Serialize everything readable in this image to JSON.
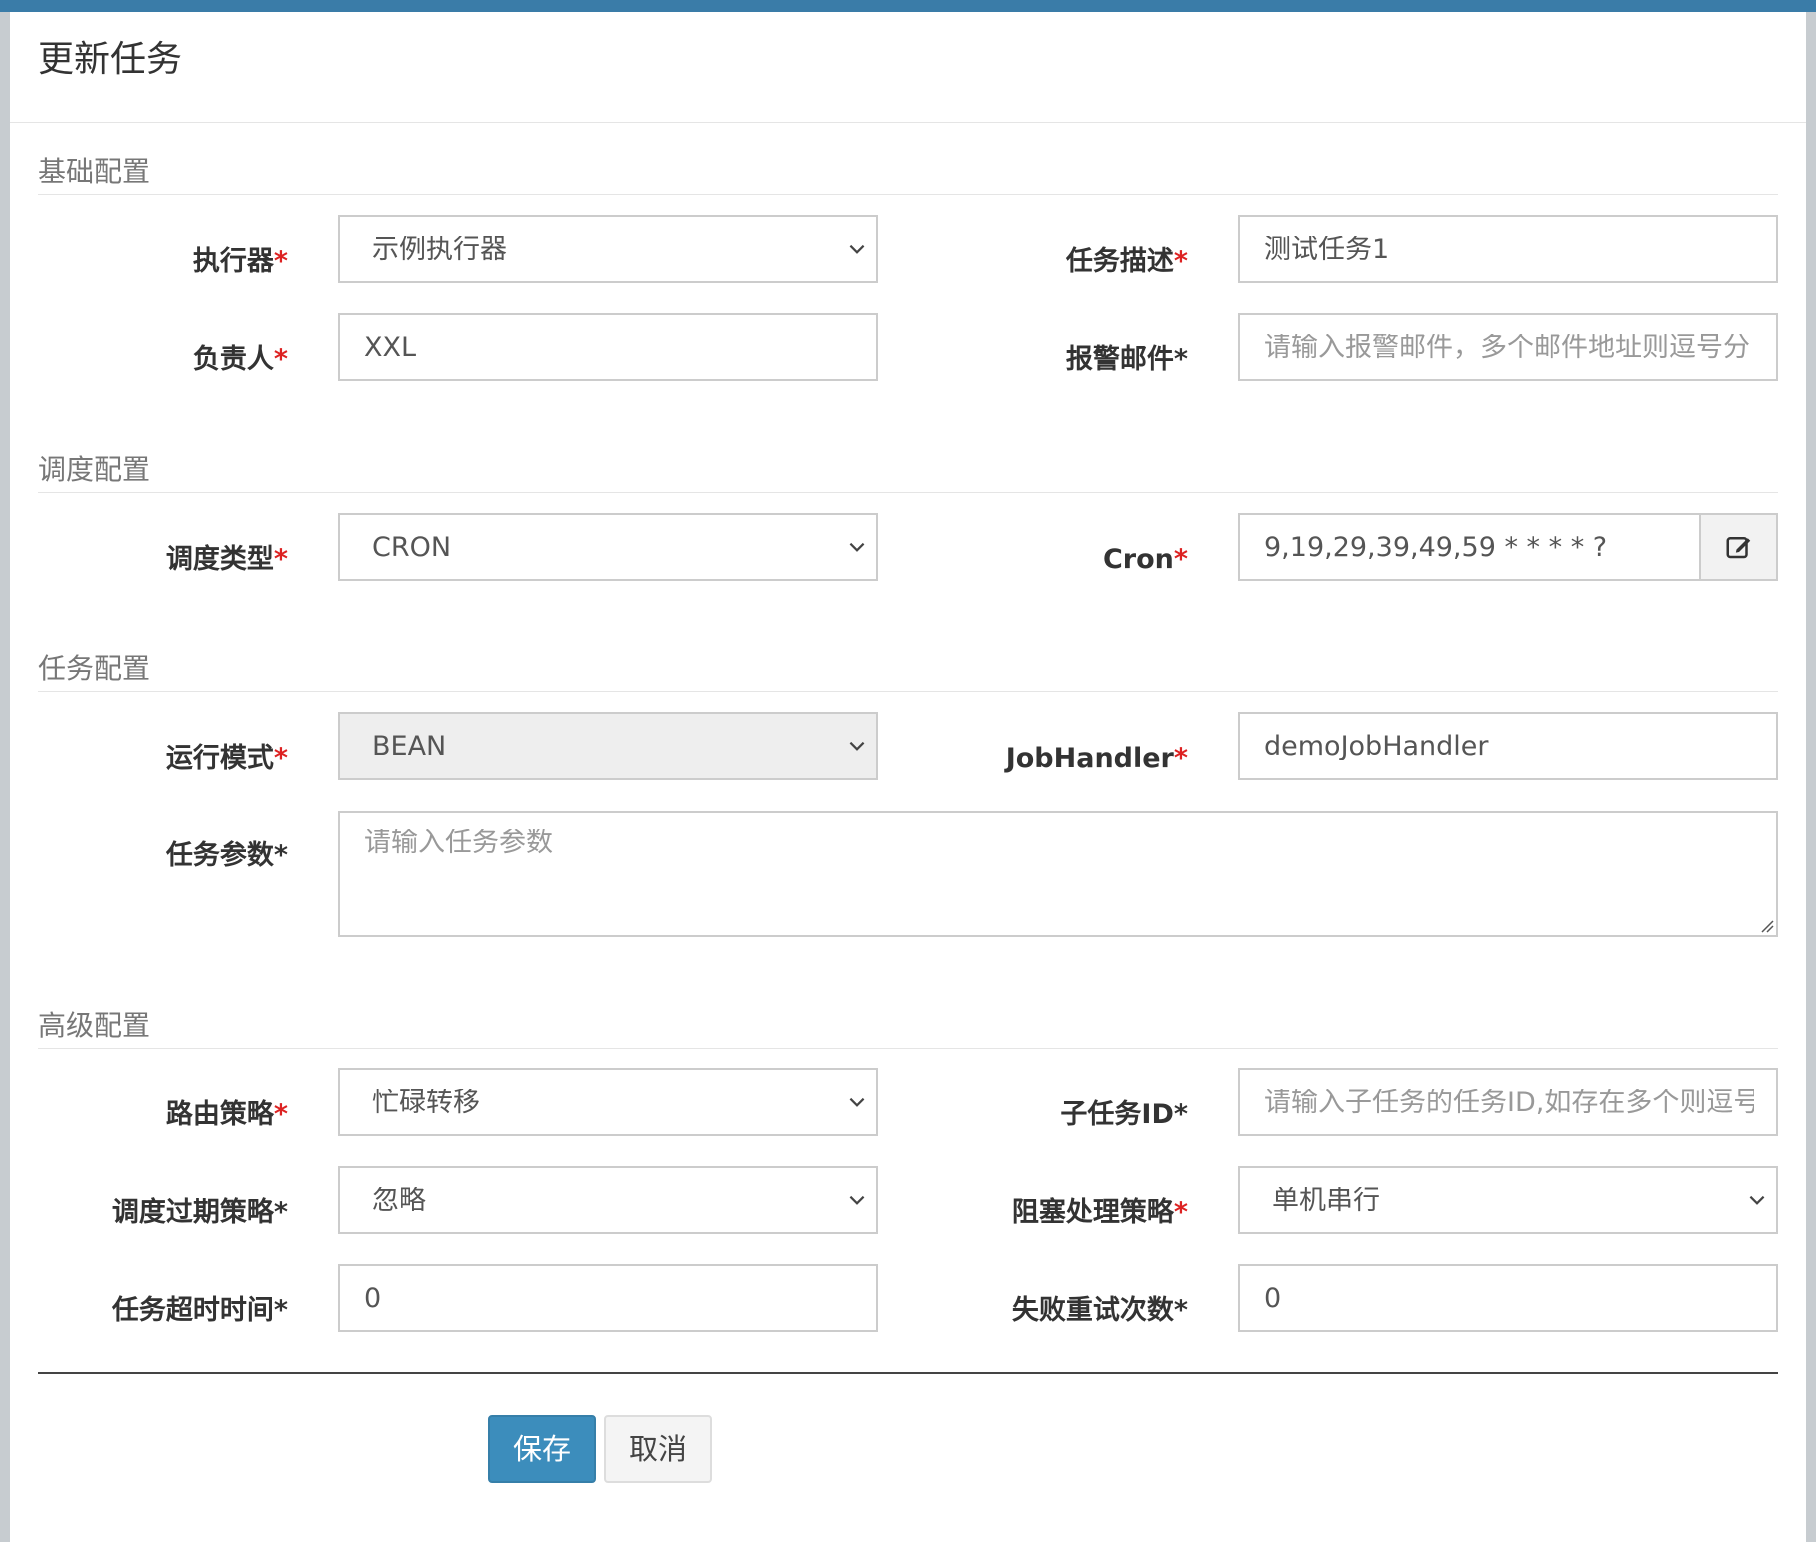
{
  "modal": {
    "title": "更新任务"
  },
  "sections": {
    "basic": "基础配置",
    "schedule": "调度配置",
    "task": "任务配置",
    "advanced": "高级配置"
  },
  "fields": {
    "executor": {
      "label": "执行器",
      "value": "示例执行器",
      "required_color": "red"
    },
    "job_desc": {
      "label": "任务描述",
      "value": "测试任务1"
    },
    "author": {
      "label": "负责人",
      "value": "XXL"
    },
    "alarm_email": {
      "label": "报警邮件",
      "placeholder": "请输入报警邮件，多个邮件地址则逗号分"
    },
    "schedule_type": {
      "label": "调度类型",
      "value": "CRON"
    },
    "cron": {
      "label": "Cron",
      "value": "9,19,29,39,49,59 * * * * ?"
    },
    "run_mode": {
      "label": "运行模式",
      "value": "BEAN"
    },
    "job_handler": {
      "label": "JobHandler",
      "value": "demoJobHandler"
    },
    "job_param": {
      "label": "任务参数",
      "placeholder": "请输入任务参数"
    },
    "route_strategy": {
      "label": "路由策略",
      "value": "忙碌转移"
    },
    "child_job_id": {
      "label": "子任务ID",
      "placeholder": "请输入子任务的任务ID,如存在多个则逗号分隔"
    },
    "misfire_strategy": {
      "label": "调度过期策略",
      "value": "忽略"
    },
    "block_strategy": {
      "label": "阻塞处理策略",
      "value": "单机串行"
    },
    "timeout": {
      "label": "任务超时时间",
      "value": "0"
    },
    "fail_retry": {
      "label": "失败重试次数",
      "value": "0"
    }
  },
  "buttons": {
    "save": "保存",
    "cancel": "取消"
  },
  "colors": {
    "primary": "#3c8dbc",
    "required": "#dd2222",
    "header_bar": "#3a7ca8"
  },
  "icons": {
    "cron_edit": "edit-icon",
    "dropdown": "chevron-down-icon"
  }
}
